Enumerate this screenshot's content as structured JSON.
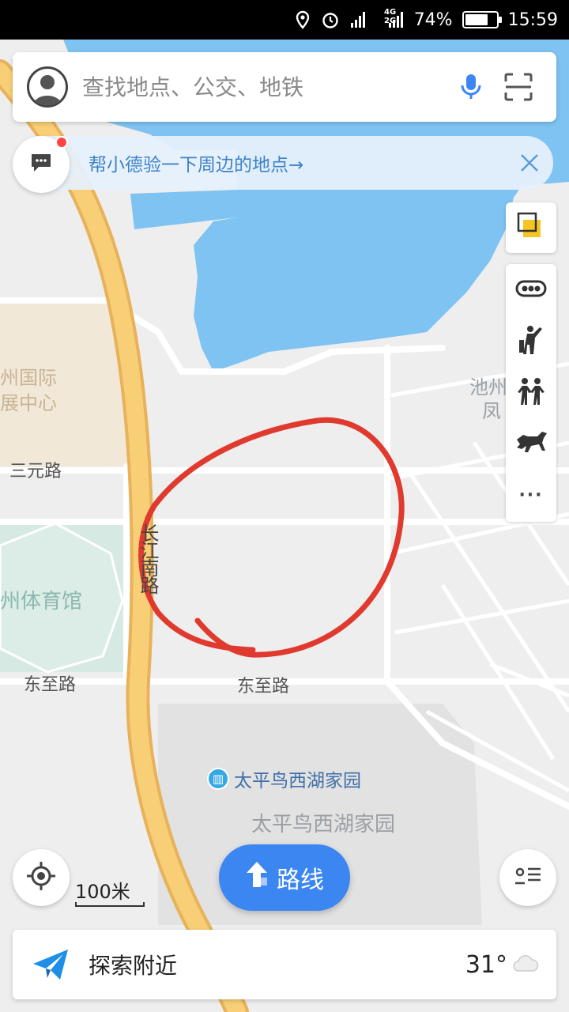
{
  "status_bar": {
    "network_labels": [
      "4G",
      "2G"
    ],
    "battery_text": "74%",
    "battery_level": 0.74,
    "time": "15:59"
  },
  "search": {
    "placeholder": "查找地点、公交、地铁"
  },
  "tip": {
    "text": "帮小德验一下周边的地点→"
  },
  "map": {
    "labels": {
      "expo_center": "州国际\n展中心",
      "sanyuan_road": "三元路",
      "stadium": "州体育馆",
      "dongzhi_road_left": "东至路",
      "dongzhi_road_center": "东至路",
      "changjiang_road": "长江南路",
      "chizhou_right": "池州",
      "feng_right": "凤",
      "poi_name": "太平鸟西湖家园",
      "area_name": "太平鸟西湖家园"
    },
    "colors": {
      "water": "#7ec3f2",
      "road_major": "#f5c468",
      "road_minor": "#ffffff",
      "block_orange": "#f1e8d8",
      "block_green": "#d6e9e2",
      "annotation": "#e03a2f"
    }
  },
  "controls": {
    "route_label": "路线",
    "scale_label": "100米",
    "more_label": "···"
  },
  "explore": {
    "label": "探索附近",
    "temperature": "31°"
  },
  "icons": [
    "location-pin-icon",
    "alarm-icon",
    "signal-icon",
    "battery-icon",
    "avatar-icon",
    "microphone-icon",
    "scan-icon",
    "message-icon",
    "close-icon",
    "layers-icon",
    "traffic-icon",
    "pedestrian-icon",
    "people-icon",
    "horse-icon",
    "locate-icon",
    "route-arrow-icon",
    "list-icon",
    "send-plane-icon",
    "cloud-icon"
  ]
}
